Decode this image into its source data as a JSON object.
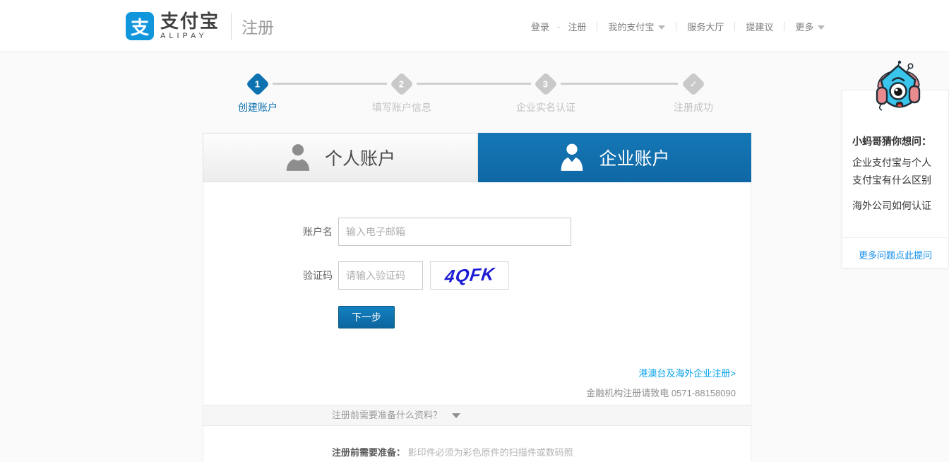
{
  "header": {
    "logo": {
      "glyph": "支",
      "brand_cn": "支付宝",
      "brand_en": "ALIPAY",
      "page_label": "注册"
    },
    "nav": {
      "login": "登录",
      "dash": "-",
      "register": "注册",
      "my_alipay": "我的支付宝",
      "service_hall": "服务大厅",
      "suggest": "提建议",
      "more": "更多"
    }
  },
  "steps": [
    {
      "num": "1",
      "label": "创建账户"
    },
    {
      "num": "2",
      "label": "填写账户信息"
    },
    {
      "num": "3",
      "label": "企业实名认证"
    },
    {
      "num": "✓",
      "label": "注册成功"
    }
  ],
  "tabs": {
    "personal": "个人账户",
    "enterprise": "企业账户"
  },
  "form": {
    "account_label": "账户名",
    "account_placeholder": "输入电子邮箱",
    "captcha_label": "验证码",
    "captcha_placeholder": "请输入验证码",
    "captcha_value": "4QFK",
    "next_button": "下一步",
    "overseas_link": "港澳台及海外企业注册>",
    "finance_note": "金融机构注册请致电 0571-88158090"
  },
  "faq_bar": {
    "question": "注册前需要准备什么资料？"
  },
  "prep": {
    "bold": "注册前需要准备：",
    "text": "影印件必须为彩色原件的扫描件或数码照"
  },
  "sidebar": {
    "title": "小蚂哥猜你想问：",
    "question1": "企业支付宝与个人支付宝有什么区别",
    "question2": "海外公司如何认证",
    "more_link": "更多问题点此提问"
  },
  "colors": {
    "accent_blue": "#108ee9",
    "tab_blue": "#0f68a5",
    "step_active": "#0e72b0",
    "captcha_blue": "#1d1bd4",
    "logo_blue": "#1296db"
  }
}
